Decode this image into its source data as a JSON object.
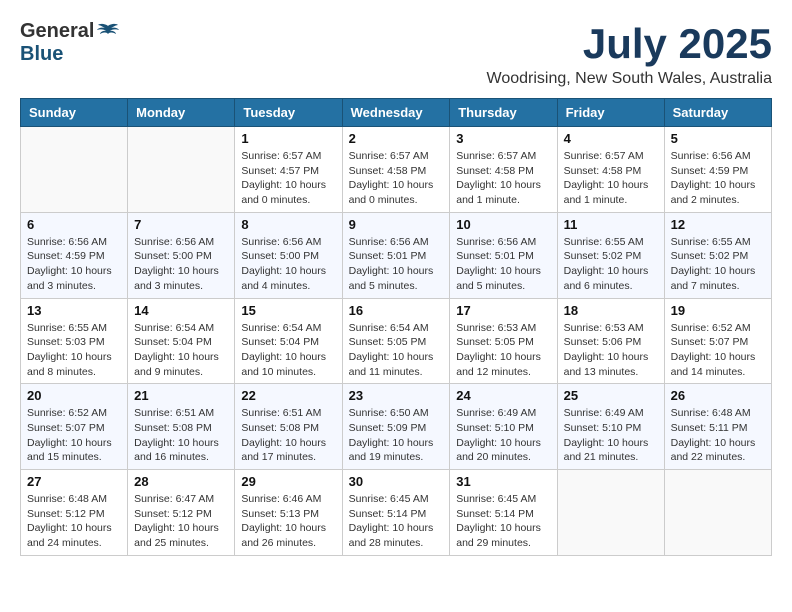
{
  "logo": {
    "general": "General",
    "blue": "Blue"
  },
  "title": {
    "month_year": "July 2025",
    "location": "Woodrising, New South Wales, Australia"
  },
  "weekdays": [
    "Sunday",
    "Monday",
    "Tuesday",
    "Wednesday",
    "Thursday",
    "Friday",
    "Saturday"
  ],
  "weeks": [
    [
      {
        "day": "",
        "info": ""
      },
      {
        "day": "",
        "info": ""
      },
      {
        "day": "1",
        "info": "Sunrise: 6:57 AM\nSunset: 4:57 PM\nDaylight: 10 hours\nand 0 minutes."
      },
      {
        "day": "2",
        "info": "Sunrise: 6:57 AM\nSunset: 4:58 PM\nDaylight: 10 hours\nand 0 minutes."
      },
      {
        "day": "3",
        "info": "Sunrise: 6:57 AM\nSunset: 4:58 PM\nDaylight: 10 hours\nand 1 minute."
      },
      {
        "day": "4",
        "info": "Sunrise: 6:57 AM\nSunset: 4:58 PM\nDaylight: 10 hours\nand 1 minute."
      },
      {
        "day": "5",
        "info": "Sunrise: 6:56 AM\nSunset: 4:59 PM\nDaylight: 10 hours\nand 2 minutes."
      }
    ],
    [
      {
        "day": "6",
        "info": "Sunrise: 6:56 AM\nSunset: 4:59 PM\nDaylight: 10 hours\nand 3 minutes."
      },
      {
        "day": "7",
        "info": "Sunrise: 6:56 AM\nSunset: 5:00 PM\nDaylight: 10 hours\nand 3 minutes."
      },
      {
        "day": "8",
        "info": "Sunrise: 6:56 AM\nSunset: 5:00 PM\nDaylight: 10 hours\nand 4 minutes."
      },
      {
        "day": "9",
        "info": "Sunrise: 6:56 AM\nSunset: 5:01 PM\nDaylight: 10 hours\nand 5 minutes."
      },
      {
        "day": "10",
        "info": "Sunrise: 6:56 AM\nSunset: 5:01 PM\nDaylight: 10 hours\nand 5 minutes."
      },
      {
        "day": "11",
        "info": "Sunrise: 6:55 AM\nSunset: 5:02 PM\nDaylight: 10 hours\nand 6 minutes."
      },
      {
        "day": "12",
        "info": "Sunrise: 6:55 AM\nSunset: 5:02 PM\nDaylight: 10 hours\nand 7 minutes."
      }
    ],
    [
      {
        "day": "13",
        "info": "Sunrise: 6:55 AM\nSunset: 5:03 PM\nDaylight: 10 hours\nand 8 minutes."
      },
      {
        "day": "14",
        "info": "Sunrise: 6:54 AM\nSunset: 5:04 PM\nDaylight: 10 hours\nand 9 minutes."
      },
      {
        "day": "15",
        "info": "Sunrise: 6:54 AM\nSunset: 5:04 PM\nDaylight: 10 hours\nand 10 minutes."
      },
      {
        "day": "16",
        "info": "Sunrise: 6:54 AM\nSunset: 5:05 PM\nDaylight: 10 hours\nand 11 minutes."
      },
      {
        "day": "17",
        "info": "Sunrise: 6:53 AM\nSunset: 5:05 PM\nDaylight: 10 hours\nand 12 minutes."
      },
      {
        "day": "18",
        "info": "Sunrise: 6:53 AM\nSunset: 5:06 PM\nDaylight: 10 hours\nand 13 minutes."
      },
      {
        "day": "19",
        "info": "Sunrise: 6:52 AM\nSunset: 5:07 PM\nDaylight: 10 hours\nand 14 minutes."
      }
    ],
    [
      {
        "day": "20",
        "info": "Sunrise: 6:52 AM\nSunset: 5:07 PM\nDaylight: 10 hours\nand 15 minutes."
      },
      {
        "day": "21",
        "info": "Sunrise: 6:51 AM\nSunset: 5:08 PM\nDaylight: 10 hours\nand 16 minutes."
      },
      {
        "day": "22",
        "info": "Sunrise: 6:51 AM\nSunset: 5:08 PM\nDaylight: 10 hours\nand 17 minutes."
      },
      {
        "day": "23",
        "info": "Sunrise: 6:50 AM\nSunset: 5:09 PM\nDaylight: 10 hours\nand 19 minutes."
      },
      {
        "day": "24",
        "info": "Sunrise: 6:49 AM\nSunset: 5:10 PM\nDaylight: 10 hours\nand 20 minutes."
      },
      {
        "day": "25",
        "info": "Sunrise: 6:49 AM\nSunset: 5:10 PM\nDaylight: 10 hours\nand 21 minutes."
      },
      {
        "day": "26",
        "info": "Sunrise: 6:48 AM\nSunset: 5:11 PM\nDaylight: 10 hours\nand 22 minutes."
      }
    ],
    [
      {
        "day": "27",
        "info": "Sunrise: 6:48 AM\nSunset: 5:12 PM\nDaylight: 10 hours\nand 24 minutes."
      },
      {
        "day": "28",
        "info": "Sunrise: 6:47 AM\nSunset: 5:12 PM\nDaylight: 10 hours\nand 25 minutes."
      },
      {
        "day": "29",
        "info": "Sunrise: 6:46 AM\nSunset: 5:13 PM\nDaylight: 10 hours\nand 26 minutes."
      },
      {
        "day": "30",
        "info": "Sunrise: 6:45 AM\nSunset: 5:14 PM\nDaylight: 10 hours\nand 28 minutes."
      },
      {
        "day": "31",
        "info": "Sunrise: 6:45 AM\nSunset: 5:14 PM\nDaylight: 10 hours\nand 29 minutes."
      },
      {
        "day": "",
        "info": ""
      },
      {
        "day": "",
        "info": ""
      }
    ]
  ]
}
